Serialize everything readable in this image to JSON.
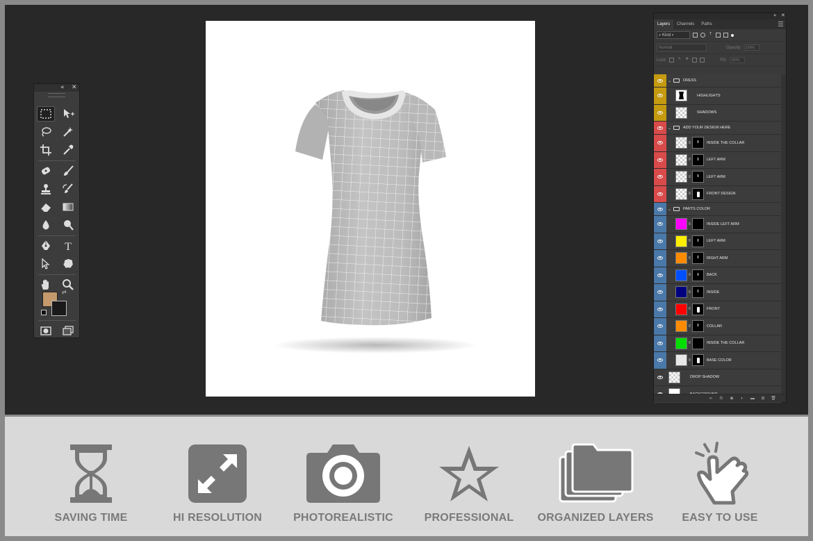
{
  "tools_panel": {
    "collapse_icon": "double-chevron-left-icon",
    "close_icon": "close-icon",
    "foreground_color": "#c49a6c",
    "background_color": "#1a1a1a",
    "tools": [
      "marquee",
      "move",
      "lasso",
      "magic-wand",
      "crop",
      "eyedropper",
      "healing-brush",
      "brush",
      "clone-stamp",
      "history-brush",
      "eraser",
      "gradient",
      "blur",
      "dodge",
      "pen",
      "type",
      "path-selection",
      "custom-shape",
      "hand",
      "zoom",
      "screen-mode",
      "artboard"
    ],
    "type_glyph": "T"
  },
  "layers_panel": {
    "tabs": [
      {
        "label": "Layers",
        "active": true
      },
      {
        "label": "Channels",
        "active": false
      },
      {
        "label": "Paths",
        "active": false
      }
    ],
    "filter_kind": "Kind",
    "blend_mode": "Normal",
    "opacity_label": "Opacity:",
    "opacity_value": "100%",
    "lock_label": "Lock:",
    "fill_label": "Fill:",
    "fill_value": "100%",
    "layers": [
      {
        "name": "DRESS",
        "kind": "group",
        "tag": "#c49a10"
      },
      {
        "name": "HIGHLIGHTS",
        "kind": "layer",
        "tag": "#c49a10",
        "thumb": "#ffffff",
        "thumb_shape": "dress"
      },
      {
        "name": "SHADOWS",
        "kind": "layer",
        "tag": "#c49a10",
        "thumb": "checker"
      },
      {
        "name": "ADD YOUR DESIGN HERE",
        "kind": "group",
        "tag": "#d94a4a"
      },
      {
        "name": "INSIDE THE COLLAR",
        "kind": "smart",
        "tag": "#d94a4a",
        "thumb": "checker",
        "mask": "dot"
      },
      {
        "name": "LEFT ARM",
        "kind": "smart",
        "tag": "#d94a4a",
        "thumb": "checker",
        "mask": "dot"
      },
      {
        "name": "LEFT ARM",
        "kind": "smart",
        "tag": "#d94a4a",
        "thumb": "checker",
        "mask": "dot"
      },
      {
        "name": "FRONT DESIGN",
        "kind": "smart",
        "tag": "#d94a4a",
        "thumb": "checker",
        "mask": "has"
      },
      {
        "name": "PARTS COLOR",
        "kind": "group",
        "tag": "#4a78a8"
      },
      {
        "name": "INSIDE LEFT ARM",
        "kind": "fill",
        "tag": "#4a78a8",
        "thumb": "#ff00ff",
        "mask": "none"
      },
      {
        "name": "LEFT ARM",
        "kind": "fill",
        "tag": "#4a78a8",
        "thumb": "#ffee00",
        "mask": "dot"
      },
      {
        "name": "RIGHT ARM",
        "kind": "fill",
        "tag": "#4a78a8",
        "thumb": "#ff8c00",
        "mask": "dot"
      },
      {
        "name": "BACK",
        "kind": "fill",
        "tag": "#4a78a8",
        "thumb": "#0050ff",
        "mask": "dot"
      },
      {
        "name": "INSIDE",
        "kind": "fill",
        "tag": "#4a78a8",
        "thumb": "#000080",
        "mask": "dot"
      },
      {
        "name": "FRONT",
        "kind": "fill",
        "tag": "#4a78a8",
        "thumb": "#ff0000",
        "mask": "has"
      },
      {
        "name": "COLLAR",
        "kind": "fill",
        "tag": "#4a78a8",
        "thumb": "#ff8c00",
        "mask": "dot"
      },
      {
        "name": "INSIDE THE COLLAR",
        "kind": "fill",
        "tag": "#4a78a8",
        "thumb": "#00dd00",
        "mask": "none"
      },
      {
        "name": "BASE COLOR",
        "kind": "fill",
        "tag": "#4a78a8",
        "thumb": "#e8e8e8",
        "mask": "has"
      },
      {
        "name": "DROP SHADOW",
        "kind": "layer",
        "tag": "none",
        "thumb": "checker"
      },
      {
        "name": "BACKGROUND",
        "kind": "layer",
        "tag": "none",
        "thumb": "#ffffff"
      }
    ],
    "bottom_icons": [
      "link-icon",
      "fx-icon",
      "mask-icon",
      "adjustment-icon",
      "folder-icon",
      "new-layer-icon",
      "trash-icon"
    ],
    "fx_glyph": "fx"
  },
  "features": [
    {
      "label": "SAVING TIME",
      "icon": "hourglass-icon"
    },
    {
      "label": "HI RESOLUTION",
      "icon": "expand-arrows-icon"
    },
    {
      "label": "PHOTOREALISTIC",
      "icon": "camera-icon"
    },
    {
      "label": "PROFESSIONAL",
      "icon": "star-icon"
    },
    {
      "label": "ORGANIZED LAYERS",
      "icon": "folders-icon"
    },
    {
      "label": "EASY TO USE",
      "icon": "tap-hand-icon"
    }
  ]
}
